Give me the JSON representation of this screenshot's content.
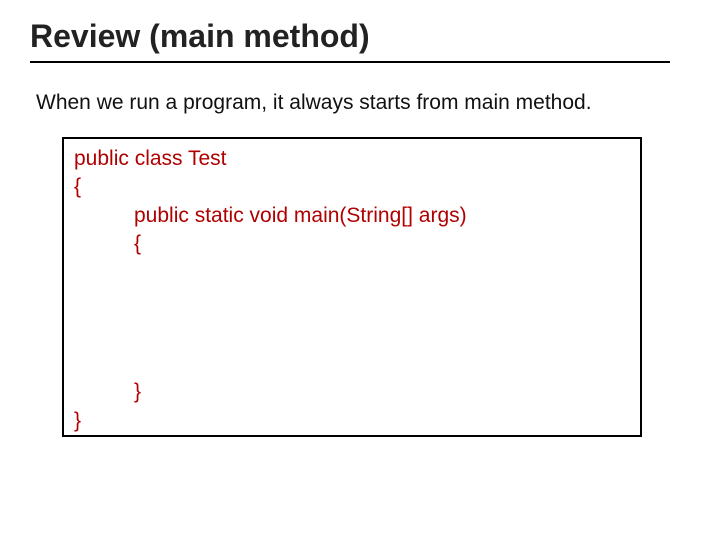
{
  "title": "Review (main method)",
  "intro": "When we run a program, it always starts from main method.",
  "code": {
    "l1": "public class Test",
    "l2": "{",
    "l3": "public static void main(String[] args)",
    "l4": "{",
    "l5": "}",
    "l6": "}"
  }
}
